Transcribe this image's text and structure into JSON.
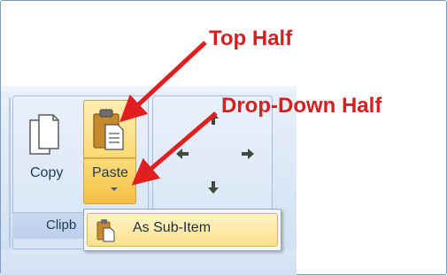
{
  "ribbon": {
    "clipboard_group_label": "Clipb",
    "copy_label": "Copy",
    "paste_label": "Paste"
  },
  "paste_menu": {
    "items": [
      {
        "label": "As Sub-Item",
        "icon": "paste-sub-item-icon"
      }
    ]
  },
  "annotations": {
    "top_half": "Top Half",
    "drop_down_half": "Drop-Down Half"
  },
  "colors": {
    "annotation": "#d42020",
    "highlight_button": "#fbd974",
    "ribbon_background": "#dce8f6"
  }
}
